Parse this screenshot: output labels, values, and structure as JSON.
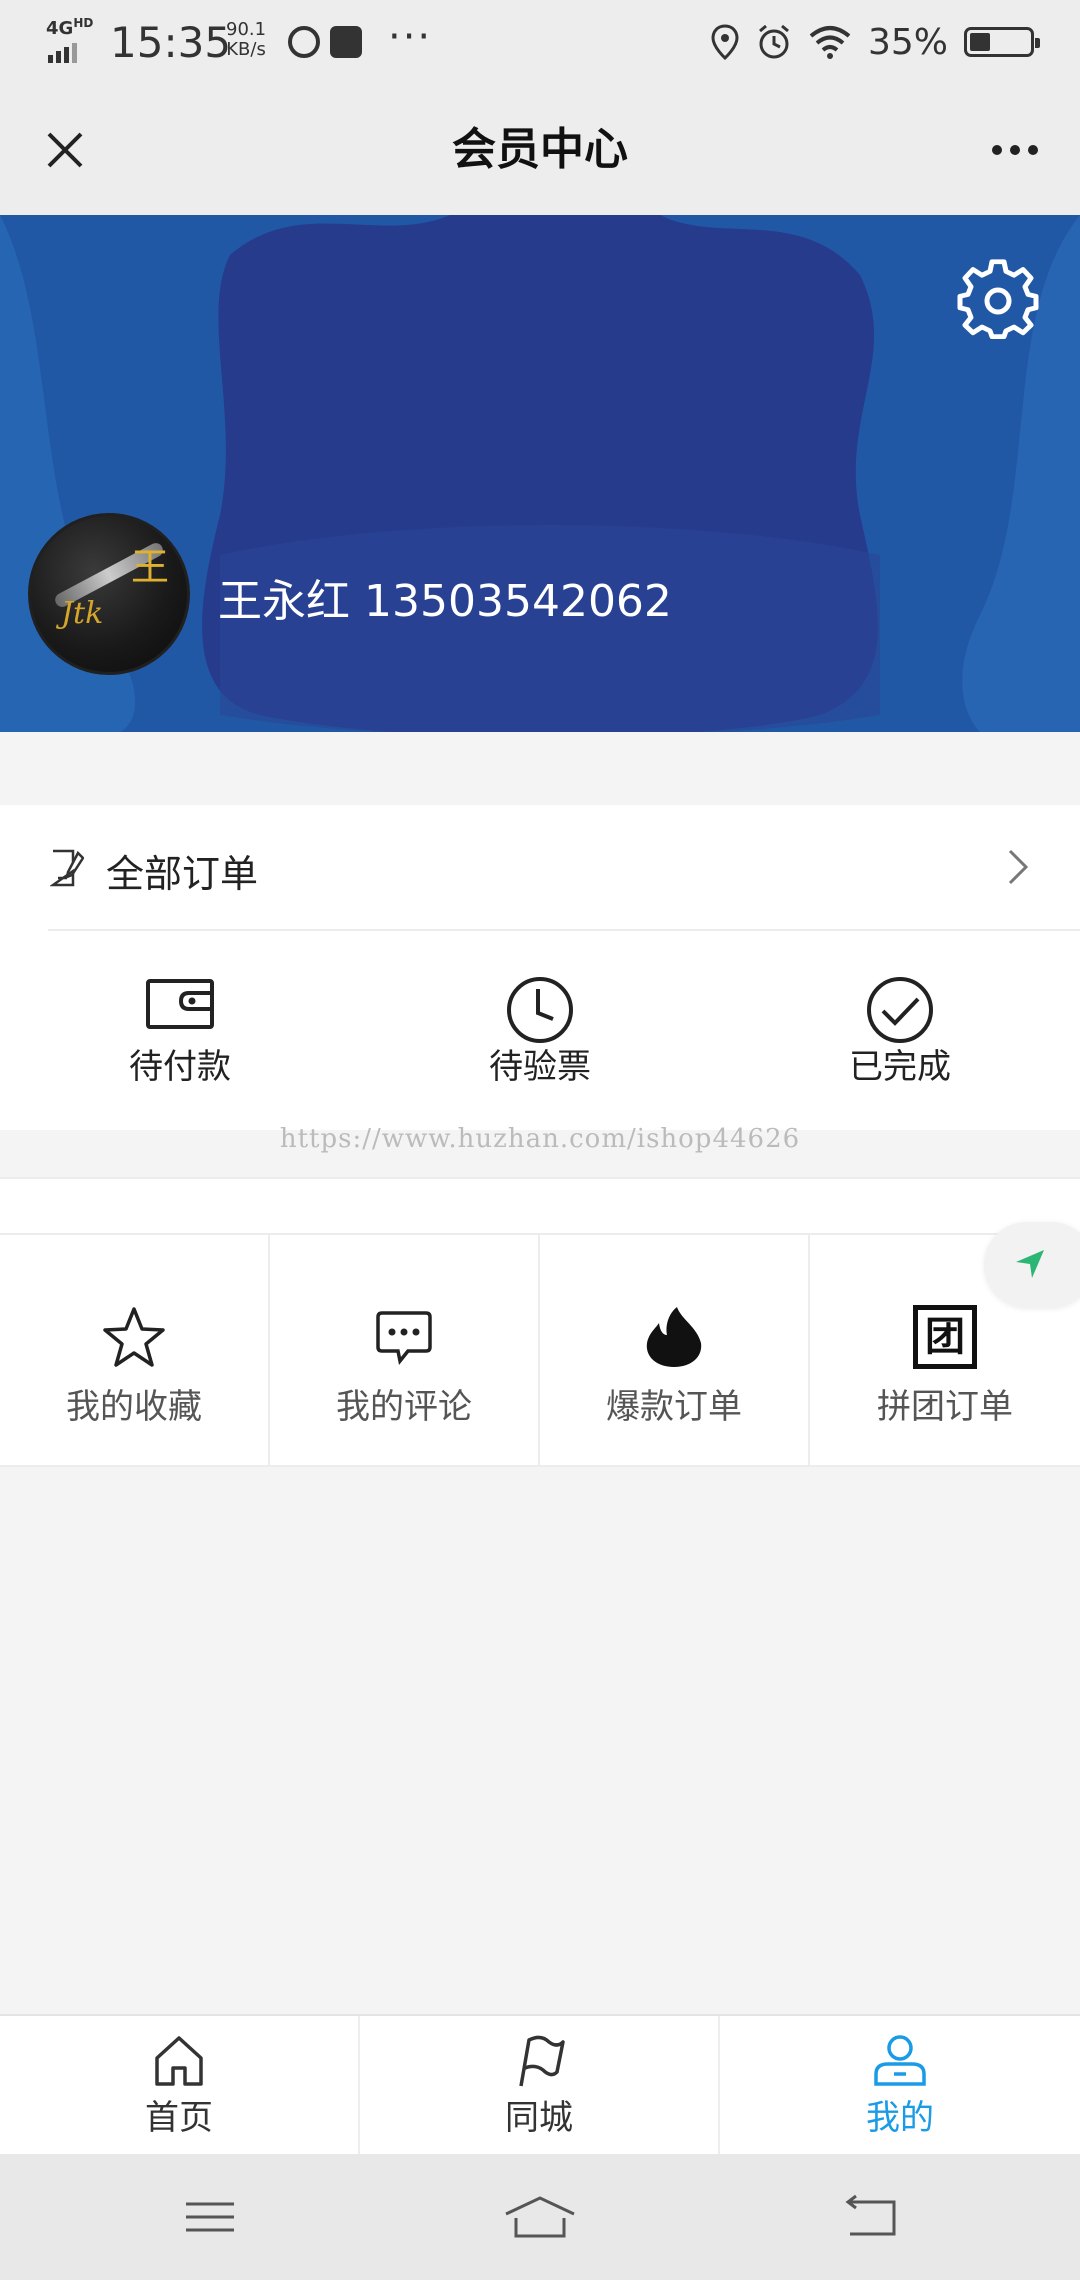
{
  "status_bar": {
    "network": "4G",
    "network_sup": "HD",
    "time": "15:35",
    "speed_value": "90.1",
    "speed_unit": "KB/s",
    "more": "···",
    "battery_text": "35%",
    "battery_level": 0.35
  },
  "nav": {
    "title": "会员中心"
  },
  "profile": {
    "user_line": "王永红 13503542062"
  },
  "orders": {
    "all_label": "全部订单",
    "statuses": [
      {
        "label": "待付款",
        "icon": "wallet-icon"
      },
      {
        "label": "待验票",
        "icon": "clock-icon"
      },
      {
        "label": "已完成",
        "icon": "check-circle-icon"
      }
    ]
  },
  "watermark": "https://www.huzhan.com/ishop44626",
  "grid": [
    {
      "label": "我的收藏",
      "icon": "star-icon"
    },
    {
      "label": "我的评论",
      "icon": "comment-icon"
    },
    {
      "label": "爆款订单",
      "icon": "fire-icon"
    },
    {
      "label": "拼团订单",
      "icon": "group-icon"
    }
  ],
  "group_icon_char": "团",
  "tabs": [
    {
      "label": "首页",
      "icon": "home-icon",
      "active": false
    },
    {
      "label": "同城",
      "icon": "flag-icon",
      "active": false
    },
    {
      "label": "我的",
      "icon": "user-icon",
      "active": true
    }
  ],
  "colors": {
    "accent": "#1a9be6",
    "banner": "#1e4f9c",
    "navigate": "#2bb673"
  }
}
